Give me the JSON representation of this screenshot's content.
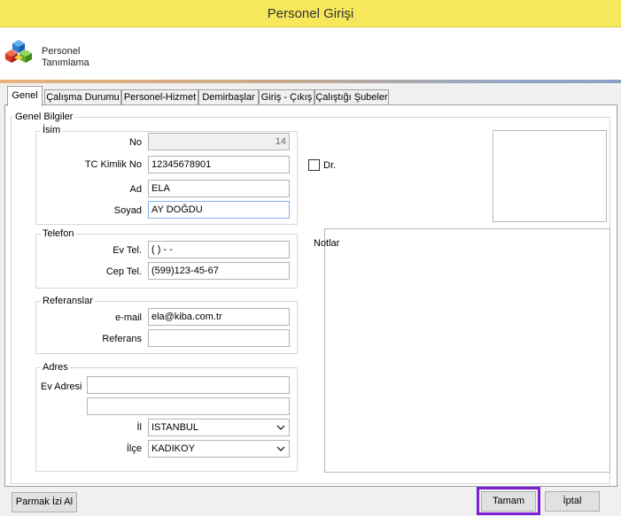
{
  "window": {
    "title": "Personel Girişi"
  },
  "header": {
    "line1": "Personel",
    "line2": "Tanımlama",
    "logo": "colored-cubes-logo"
  },
  "tabs": [
    {
      "label": "Genel"
    },
    {
      "label": "Çalışma Durumu"
    },
    {
      "label": "Personel-Hizmet"
    },
    {
      "label": "Demirbaşlar"
    },
    {
      "label": "Giriş - Çıkış"
    },
    {
      "label": "Çalıştığı Şubeler"
    }
  ],
  "general": {
    "title": "Genel Bilgiler",
    "isim": {
      "title": "İsim",
      "no_label": "No",
      "no_value": "14",
      "tc_label": "TC Kimlik No",
      "tc_value": "12345678901",
      "ad_label": "Ad",
      "ad_value": "ELA",
      "soyad_label": "Soyad",
      "soyad_value": "AY DOĞDU"
    },
    "dr_label": "Dr.",
    "telefon": {
      "title": "Telefon",
      "ev_label": "Ev Tel.",
      "ev_value": "(   )   -  -",
      "cep_label": "Cep Tel.",
      "cep_value": "(599)123-45-67"
    },
    "referanslar": {
      "title": "Referanslar",
      "email_label": "e-mail",
      "email_value": "ela@kiba.com.tr",
      "referans_label": "Referans",
      "referans_value": ""
    },
    "adres": {
      "title": "Adres",
      "ev_adresi_label": "Ev Adresi",
      "line1": "",
      "line2": "",
      "il_label": "İl",
      "il_value": "ISTANBUL",
      "ilce_label": "İlçe",
      "ilce_value": "KADIKOY"
    },
    "notlar_label": "Notlar"
  },
  "footer": {
    "fingerprint_label": "Parmak İzi Al",
    "ok_label": "Tamam",
    "cancel_label": "İptal"
  },
  "colors": {
    "titlebar": "#f6e85a",
    "focus_outline": "#7a1fd6"
  }
}
